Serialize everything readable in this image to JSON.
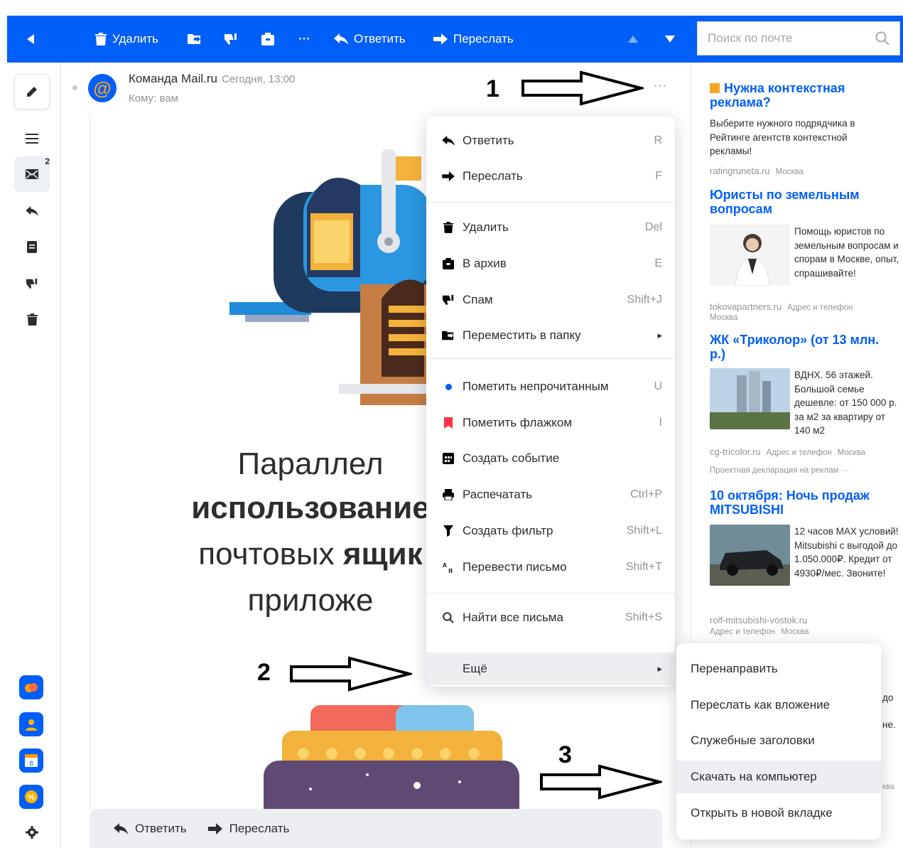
{
  "toolbar": {
    "delete_label": "Удалить",
    "reply_label": "Ответить",
    "forward_label": "Переслать",
    "search_placeholder": "Поиск по почте"
  },
  "rail": {
    "inbox_badge": "2"
  },
  "letter": {
    "sender": "Команда Mail.ru",
    "date": "Сегодня, 13:00",
    "to": "Кому: вам",
    "line1": "Параллел",
    "line2": "использование",
    "line3a": "почтовых ",
    "line3b": "ящик",
    "line4": "приложе"
  },
  "reply_bar": {
    "reply": "Ответить",
    "forward": "Переслать"
  },
  "menu": {
    "items": [
      {
        "label": "Ответить",
        "shortcut": "R"
      },
      {
        "label": "Переслать",
        "shortcut": "F"
      },
      {
        "label": "Удалить",
        "shortcut": "Del"
      },
      {
        "label": "В архив",
        "shortcut": "E"
      },
      {
        "label": "Спам",
        "shortcut": "Shift+J"
      },
      {
        "label": "Переместить в папку",
        "shortcut": "▸"
      },
      {
        "label": "Пометить непрочитанным",
        "shortcut": "U"
      },
      {
        "label": "Пометить флажком",
        "shortcut": "I"
      },
      {
        "label": "Создать событие",
        "shortcut": ""
      },
      {
        "label": "Распечатать",
        "shortcut": "Ctrl+P"
      },
      {
        "label": "Создать фильтр",
        "shortcut": "Shift+L"
      },
      {
        "label": "Перевести письмо",
        "shortcut": "Shift+T"
      },
      {
        "label": "Найти все письма",
        "shortcut": "Shift+S"
      },
      {
        "label": "Ещё",
        "shortcut": "▸"
      }
    ]
  },
  "submenu": {
    "items": [
      {
        "label": "Перенаправить"
      },
      {
        "label": "Переслать как вложение"
      },
      {
        "label": "Служебные заголовки"
      },
      {
        "label": "Скачать на компьютер"
      },
      {
        "label": "Открыть в новой вкладке"
      }
    ]
  },
  "ads": {
    "ad1": {
      "title": "Нужна контекстная реклама?",
      "text": "Выберите нужного подрядчика в Рейтинге агентств контекстной рекламы!",
      "domain": "ratingruneta.ru",
      "city": "Москва"
    },
    "ad2": {
      "title": "Юристы по земельным вопросам",
      "text": "Помощь юристов по земельным вопросам и спорам в Москве, опыт, спрашивайте!",
      "domain": "tokovapartners.ru",
      "extra": "Адрес и телефон",
      "city": "Москва"
    },
    "ad3": {
      "title": "ЖК «Триколор» (от 13 млн. р.)",
      "text": "ВДНХ. 56 этажей. Большой семье дешевле: от 150 000 р. за м2 за квартиру от 140 м2",
      "domain": "cg-tricolor.ru",
      "extra": "Адрес и телефон",
      "city": "Москва",
      "decl": "Проектная декларация на реклам"
    },
    "ad4": {
      "title": "10 октября: Ночь продаж MITSUBISHI",
      "text": "12 часов MAX условий! Mitsubishi с выгодой до 1.050.000₽. Кредит от 4930₽/мес. Звоните!",
      "domain": "rolf-mitsubishi-vostok.ru",
      "extra": "Адрес и телефон",
      "city": "Москва"
    },
    "fragments": [
      "до",
      "не.",
      "ква"
    ]
  },
  "annotations": {
    "n1": "1",
    "n2": "2",
    "n3": "3"
  },
  "colors": {
    "brand": "#005ff9",
    "flag": "#ff3047",
    "link": "#005ff9"
  }
}
